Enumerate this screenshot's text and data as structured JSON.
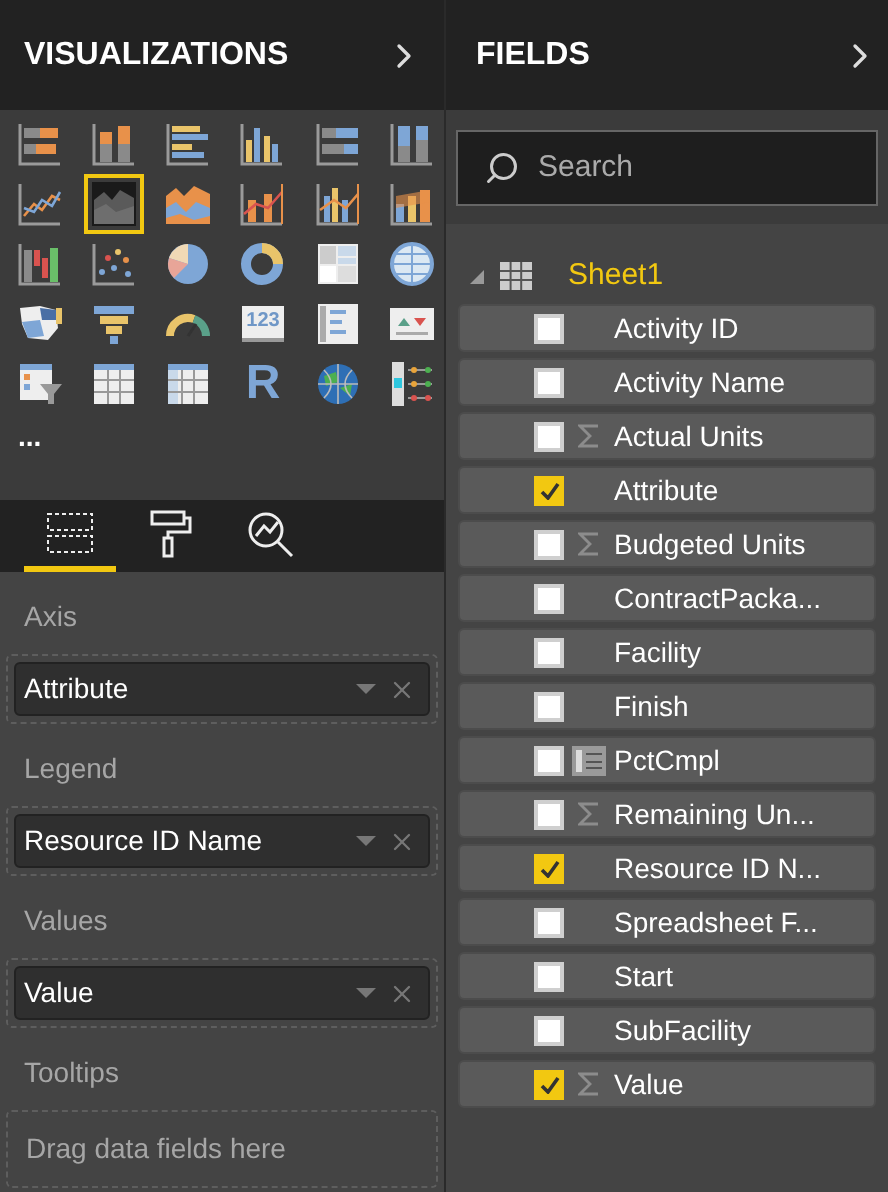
{
  "visualizations": {
    "title": "VISUALIZATIONS",
    "types": [
      {
        "kind": "stacked-bar",
        "selected": false
      },
      {
        "kind": "stacked-column",
        "selected": false
      },
      {
        "kind": "clustered-bar",
        "selected": false
      },
      {
        "kind": "clustered-column",
        "selected": false
      },
      {
        "kind": "stacked-bar-100",
        "selected": false
      },
      {
        "kind": "stacked-column-100",
        "selected": false
      },
      {
        "kind": "line",
        "selected": false
      },
      {
        "kind": "area",
        "selected": true
      },
      {
        "kind": "stacked-area",
        "selected": false
      },
      {
        "kind": "line-column",
        "selected": false
      },
      {
        "kind": "line-clustered",
        "selected": false
      },
      {
        "kind": "ribbon",
        "selected": false
      },
      {
        "kind": "waterfall",
        "selected": false
      },
      {
        "kind": "scatter",
        "selected": false
      },
      {
        "kind": "pie",
        "selected": false
      },
      {
        "kind": "donut",
        "selected": false
      },
      {
        "kind": "treemap",
        "selected": false
      },
      {
        "kind": "map",
        "selected": false
      },
      {
        "kind": "filled-map",
        "selected": false
      },
      {
        "kind": "funnel",
        "selected": false
      },
      {
        "kind": "gauge",
        "selected": false
      },
      {
        "kind": "card",
        "selected": false,
        "label": "123"
      },
      {
        "kind": "multirow-card",
        "selected": false
      },
      {
        "kind": "kpi",
        "selected": false
      },
      {
        "kind": "slicer",
        "selected": false
      },
      {
        "kind": "table",
        "selected": false
      },
      {
        "kind": "matrix",
        "selected": false
      },
      {
        "kind": "r-script",
        "selected": false,
        "label": "R"
      },
      {
        "kind": "globe",
        "selected": false
      },
      {
        "kind": "timeline",
        "selected": false
      }
    ],
    "more": "...",
    "tabs": [
      {
        "kind": "fields",
        "selected": true
      },
      {
        "kind": "format",
        "selected": false
      },
      {
        "kind": "analytics",
        "selected": false
      }
    ],
    "wells": [
      {
        "label": "Axis",
        "field": "Attribute"
      },
      {
        "label": "Legend",
        "field": "Resource ID Name"
      },
      {
        "label": "Values",
        "field": "Value"
      },
      {
        "label": "Tooltips",
        "placeholder": "Drag data fields here"
      }
    ]
  },
  "fields": {
    "title": "FIELDS",
    "search": {
      "placeholder": "Search"
    },
    "table": {
      "name": "Sheet1",
      "expanded": true,
      "children": [
        {
          "name": "Activity ID",
          "checked": false,
          "kind": "text"
        },
        {
          "name": "Activity Name",
          "checked": false,
          "kind": "text"
        },
        {
          "name": "Actual Units",
          "checked": false,
          "kind": "sum"
        },
        {
          "name": "Attribute",
          "checked": true,
          "kind": "text"
        },
        {
          "name": "Budgeted Units",
          "checked": false,
          "kind": "sum"
        },
        {
          "name": "ContractPacka...",
          "checked": false,
          "kind": "text"
        },
        {
          "name": "Facility",
          "checked": false,
          "kind": "text"
        },
        {
          "name": "Finish",
          "checked": false,
          "kind": "text"
        },
        {
          "name": "PctCmpl",
          "checked": false,
          "kind": "calc"
        },
        {
          "name": "Remaining Un...",
          "checked": false,
          "kind": "sum"
        },
        {
          "name": "Resource ID N...",
          "checked": true,
          "kind": "text"
        },
        {
          "name": "Spreadsheet F...",
          "checked": false,
          "kind": "text"
        },
        {
          "name": "Start",
          "checked": false,
          "kind": "text"
        },
        {
          "name": "SubFacility",
          "checked": false,
          "kind": "text"
        },
        {
          "name": "Value",
          "checked": true,
          "kind": "sum"
        }
      ]
    }
  }
}
